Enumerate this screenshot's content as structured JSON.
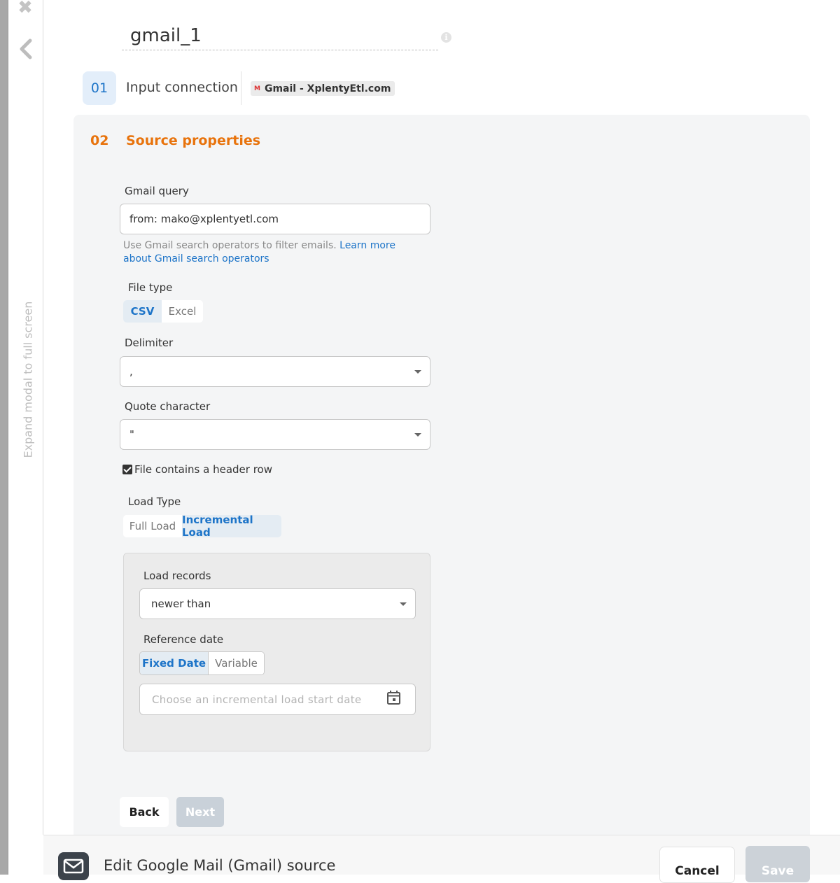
{
  "modal": {
    "title": "gmail_1",
    "expand_text": "Expand modal to full screen"
  },
  "step1": {
    "number": "01",
    "label": "Input connection",
    "connection": "Gmail - XplentyEtl.com",
    "connection_icon_text": "M"
  },
  "step2": {
    "number": "02",
    "title": "Source properties",
    "gmail_query": {
      "label": "Gmail query",
      "value": "from: mako@xplentyetl.com",
      "help_text": "Use Gmail search operators to filter emails. ",
      "help_link": "Learn more about Gmail search operators"
    },
    "file_type": {
      "label": "File type",
      "options": [
        "CSV",
        "Excel"
      ],
      "selected": "CSV"
    },
    "delimiter": {
      "label": "Delimiter",
      "value": ","
    },
    "quote_character": {
      "label": "Quote character",
      "value": "\""
    },
    "header_row": {
      "label": "File contains a header row",
      "checked": true
    },
    "load_type": {
      "label": "Load Type",
      "options": [
        "Full Load",
        "Incremental Load"
      ],
      "selected": "Incremental Load"
    },
    "incremental": {
      "load_records_label": "Load records",
      "load_records_value": "newer than",
      "reference_date_label": "Reference date",
      "reference_options": [
        "Fixed Date",
        "Variable"
      ],
      "reference_selected": "Fixed Date",
      "date_placeholder": "Choose an incremental load start date"
    },
    "back_label": "Back",
    "next_label": "Next"
  },
  "footer": {
    "title": "Edit Google Mail (Gmail) source",
    "cancel_label": "Cancel",
    "save_label": "Save"
  },
  "colors": {
    "accent_blue": "#1d74c8",
    "accent_orange": "#e8730c"
  }
}
